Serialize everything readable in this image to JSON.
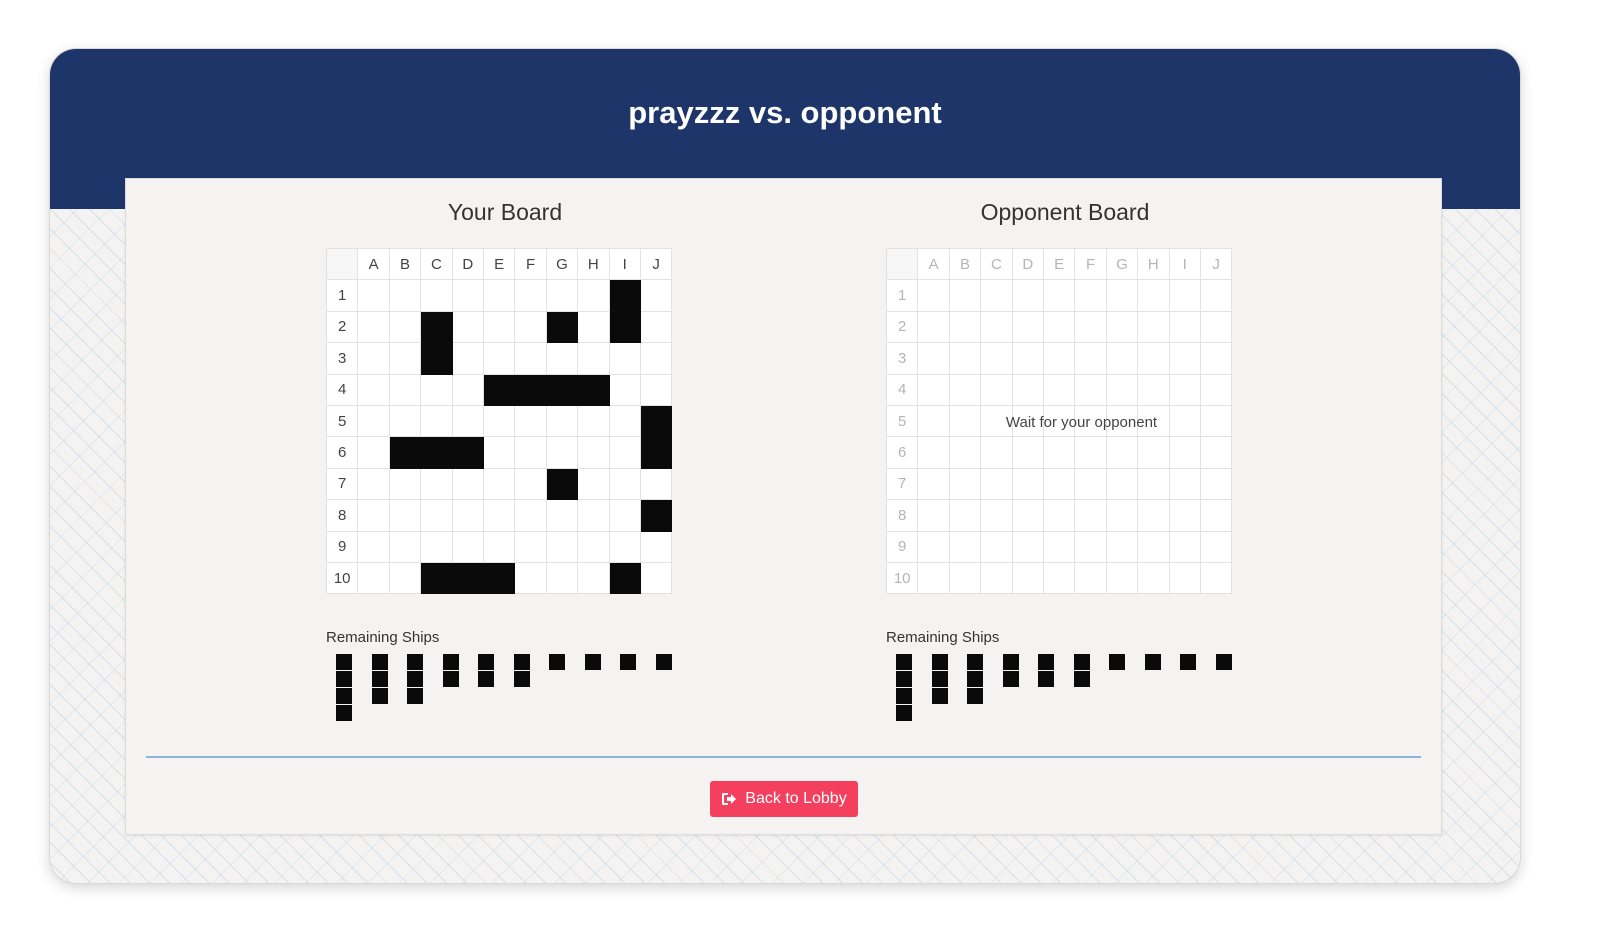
{
  "title": "prayzzz vs. opponent",
  "columns": [
    "A",
    "B",
    "C",
    "D",
    "E",
    "F",
    "G",
    "H",
    "I",
    "J"
  ],
  "rows": [
    "1",
    "2",
    "3",
    "4",
    "5",
    "6",
    "7",
    "8",
    "9",
    "10"
  ],
  "your_board": {
    "title": "Your Board",
    "ship_cells": [
      "I1",
      "C2",
      "G2",
      "I2",
      "C3",
      "E4",
      "F4",
      "G4",
      "H4",
      "J5",
      "B6",
      "C6",
      "D6",
      "J6",
      "G7",
      "J8",
      "C10",
      "D10",
      "E10",
      "I10"
    ],
    "remaining_label": "Remaining Ships",
    "remaining_ships": [
      4,
      3,
      3,
      2,
      2,
      2,
      1,
      1,
      1,
      1
    ]
  },
  "opponent_board": {
    "title": "Opponent Board",
    "status_message": "Wait for your opponent",
    "remaining_label": "Remaining Ships",
    "remaining_ships": [
      4,
      3,
      3,
      2,
      2,
      2,
      1,
      1,
      1,
      1
    ]
  },
  "back_button": {
    "label": "Back to Lobby",
    "icon": "sign-out-icon"
  },
  "colors": {
    "header": "#1e3569",
    "ship": "#0a0a0a",
    "button": "#f43f5e",
    "divider": "#8fb4d9"
  }
}
